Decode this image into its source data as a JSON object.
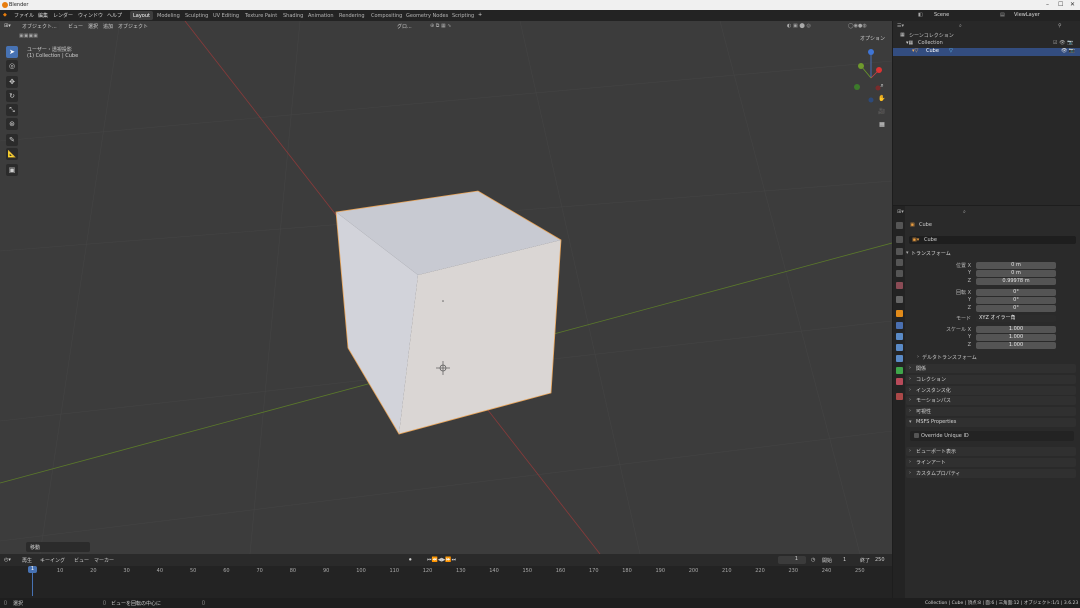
{
  "app": {
    "title": "Blender",
    "brand_color": "#e87d0d",
    "accent": "#4772b3"
  },
  "menu": [
    "ファイル",
    "編集",
    "レンダー",
    "ウィンドウ",
    "ヘルプ"
  ],
  "workspaces": [
    "Layout",
    "Modeling",
    "Sculpting",
    "UV Editing",
    "Texture Paint",
    "Shading",
    "Animation",
    "Rendering",
    "Compositing",
    "Geometry Nodes",
    "Scripting"
  ],
  "active_workspace": "Layout",
  "scene": {
    "label": "Scene",
    "view_layer": "ViewLayer"
  },
  "viewport": {
    "mode": "オブジェクト...",
    "menu": [
      "ビュー",
      "選択",
      "追加",
      "オブジェクト"
    ],
    "transform_orient": "グロ...",
    "options_label": "オプション",
    "view_name": "ユーザー・透視投影",
    "view_context": "(1) Collection | Cube",
    "last_op": "移動"
  },
  "outliner": {
    "root": "シーンコレクション",
    "collection": "Collection",
    "object": "Cube"
  },
  "properties": {
    "object_name": "Cube",
    "object_data_name": "Cube",
    "transform_title": "トランスフォーム",
    "location_label": "位置 X",
    "loc": {
      "x": "0 m",
      "y": "0 m",
      "z": "0.99978 m"
    },
    "rotation_label": "回転 X",
    "rot": {
      "x": "0°",
      "y": "0°",
      "z": "0°"
    },
    "mode_label": "モード",
    "rotation_mode": "XYZ オイラー角",
    "scale_label": "スケール X",
    "scale": {
      "x": "1.000",
      "y": "1.000",
      "z": "1.000"
    },
    "y_label": "Y",
    "z_label": "Z",
    "delta": "デルタトランスフォーム",
    "sections": [
      "関係",
      "コレクション",
      "インスタンス化",
      "モーションパス",
      "可視性"
    ],
    "msfs": "MSFS Properties",
    "override": "Override Unique ID",
    "sections2": [
      "ビューポート表示",
      "ラインアート",
      "カスタムプロパティ"
    ]
  },
  "timeline": {
    "menu": [
      "再生",
      "キーイング",
      "ビュー",
      "マーカー"
    ],
    "current_frame": "1",
    "start_label": "開始",
    "start": "1",
    "end_label": "終了",
    "end": "250",
    "ticks": [
      "1",
      "10",
      "20",
      "30",
      "40",
      "50",
      "60",
      "70",
      "80",
      "90",
      "100",
      "110",
      "120",
      "130",
      "140",
      "150",
      "160",
      "170",
      "180",
      "190",
      "200",
      "210",
      "220",
      "230",
      "240",
      "250"
    ]
  },
  "status": {
    "left": "選択",
    "middle": "ビューを回転の中心に",
    "right": "Collection | Cube | 頂点:8 | 面:6 | 三角面:12 | オブジェクト:1/1 | 3.6.23"
  }
}
